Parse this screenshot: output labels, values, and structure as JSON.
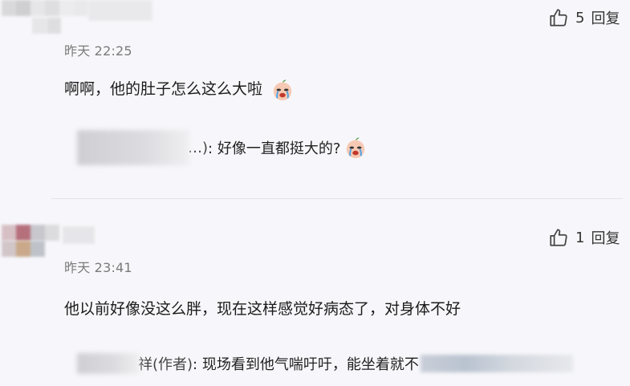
{
  "comments": [
    {
      "time": "昨天 22:25",
      "like_count": "5",
      "reply_label": "回复",
      "text": "啊啊，他的肚子怎么这么大啦",
      "reply": {
        "name_tail": "…)",
        "text": ": 好像一直都挺大的?"
      }
    },
    {
      "time": "昨天 23:41",
      "like_count": "1",
      "reply_label": "回复",
      "text": "他以前好像没这么胖，现在这样感觉好病态了，对身体不好",
      "reply": {
        "name_tail": "祥(作者)",
        "text": ": 现场看到他气喘吁吁，能坐着就不"
      }
    }
  ],
  "colors": {
    "background": "#f7f7fb",
    "text": "#1b1b1b",
    "muted": "#7a7a7a"
  },
  "icons": [
    "thumbs-up-icon",
    "crying-emoji-icon"
  ]
}
